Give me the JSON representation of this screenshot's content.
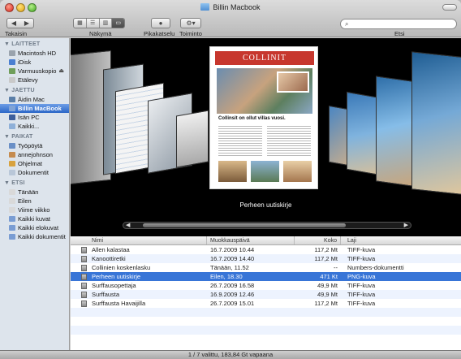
{
  "window": {
    "title": "Billin Macbook"
  },
  "toolbar": {
    "back_label": "Takaisin",
    "view_label": "Näkymä",
    "quicklook_label": "Pikakatselu",
    "action_label": "Toiminto",
    "search_label": "Etsi",
    "search_placeholder": ""
  },
  "sidebar": {
    "sections": [
      {
        "title": "LAITTEET",
        "items": [
          {
            "label": "Macintosh HD",
            "icon": "hard-drive-icon",
            "eject": false
          },
          {
            "label": "iDisk",
            "icon": "idisk-icon",
            "eject": false
          },
          {
            "label": "Varmuuskopio",
            "icon": "backup-drive-icon",
            "eject": true
          },
          {
            "label": "Etälevy",
            "icon": "remote-disc-icon",
            "eject": false
          }
        ]
      },
      {
        "title": "JAETTU",
        "items": [
          {
            "label": "Äidin Mac",
            "icon": "computer-icon",
            "eject": false
          },
          {
            "label": "Billin MacBook",
            "icon": "laptop-icon",
            "eject": false,
            "selected": true
          },
          {
            "label": "Isän PC",
            "icon": "pc-icon",
            "eject": false
          },
          {
            "label": "Kaikki...",
            "icon": "network-icon",
            "eject": false
          }
        ]
      },
      {
        "title": "PAIKAT",
        "items": [
          {
            "label": "Työpöytä",
            "icon": "desktop-icon",
            "eject": false
          },
          {
            "label": "annejohnson",
            "icon": "home-icon",
            "eject": false
          },
          {
            "label": "Ohjelmat",
            "icon": "applications-icon",
            "eject": false
          },
          {
            "label": "Dokumentit",
            "icon": "documents-icon",
            "eject": false
          }
        ]
      },
      {
        "title": "ETSI",
        "items": [
          {
            "label": "Tänään",
            "icon": "clock-icon",
            "eject": false
          },
          {
            "label": "Eilen",
            "icon": "clock-icon",
            "eject": false
          },
          {
            "label": "Viime viikko",
            "icon": "clock-icon",
            "eject": false
          },
          {
            "label": "Kaikki kuvat",
            "icon": "smart-folder-icon",
            "eject": false
          },
          {
            "label": "Kaikki elokuvat",
            "icon": "smart-folder-icon",
            "eject": false
          },
          {
            "label": "Kaikki dokumentit",
            "icon": "smart-folder-icon",
            "eject": false
          }
        ]
      }
    ]
  },
  "coverflow": {
    "selected_title": "Perheen uutiskirje",
    "cover_heading": "COLLINIT",
    "cover_headline": "Collinsit on ollut villas vuosi."
  },
  "list": {
    "columns": [
      "Nimi",
      "Muokkauspäivä",
      "Koko",
      "Laji"
    ],
    "rows": [
      {
        "name": "Allen kalastaa",
        "date": "16.7.2009 10.44",
        "size": "117,2 Mt",
        "kind": "TIFF-kuva"
      },
      {
        "name": "Kanoottiretki",
        "date": "16.7.2009 14.40",
        "size": "117,2 Mt",
        "kind": "TIFF-kuva"
      },
      {
        "name": "Collinien koskenlasku",
        "date": "Tänään, 11.52",
        "size": "--",
        "kind": "Numbers-dokumentti"
      },
      {
        "name": "Perheen uutiskirje",
        "date": "Eilen, 18.30",
        "size": "471 Kt",
        "kind": "PNG-kuva",
        "selected": true
      },
      {
        "name": "Surffausopettaja",
        "date": "26.7.2009 16.58",
        "size": "49,9 Mt",
        "kind": "TIFF-kuva"
      },
      {
        "name": "Surffausta",
        "date": "16.9.2009 12.46",
        "size": "49,9 Mt",
        "kind": "TIFF-kuva"
      },
      {
        "name": "Surffausta Havaijilla",
        "date": "26.7.2009 15.01",
        "size": "117,2 Mt",
        "kind": "TIFF-kuva"
      }
    ]
  },
  "status": {
    "text": "1 / 7 valittu, 183,84 Gt vapaana"
  }
}
